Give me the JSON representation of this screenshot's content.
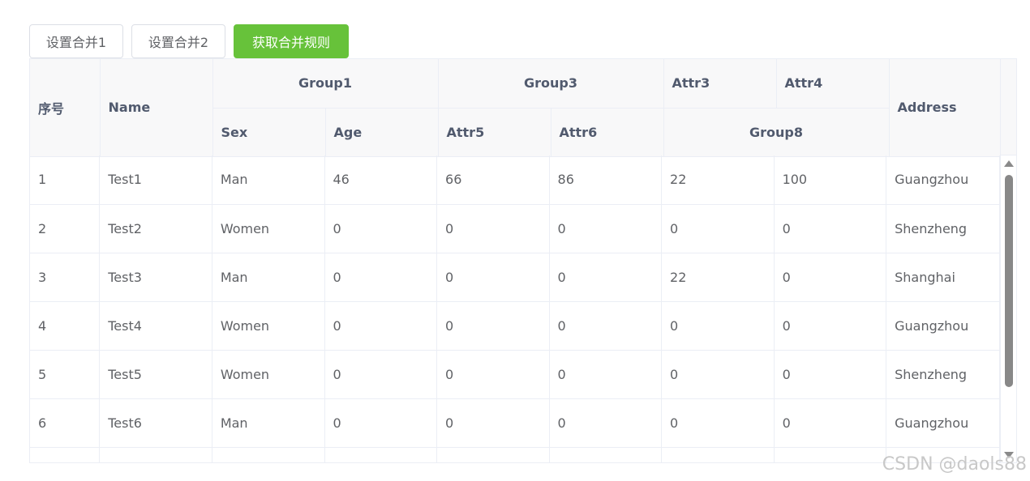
{
  "toolbar": {
    "btn1": "设置合并1",
    "btn2": "设置合并2",
    "btn3": "获取合并规则",
    "primary_color": "#67c23a"
  },
  "header": {
    "index": "序号",
    "name": "Name",
    "group1": "Group1",
    "group3": "Group3",
    "attr3": "Attr3",
    "attr4": "Attr4",
    "address": "Address",
    "sex": "Sex",
    "age": "Age",
    "attr5": "Attr5",
    "attr6": "Attr6",
    "group8": "Group8"
  },
  "rows": [
    {
      "index": "1",
      "name": "Test1",
      "sex": "Man",
      "age": "46",
      "attr5": "66",
      "attr6": "86",
      "attr3": "22",
      "attr4": "100",
      "address": "Guangzhou"
    },
    {
      "index": "2",
      "name": "Test2",
      "sex": "Women",
      "age": "0",
      "attr5": "0",
      "attr6": "0",
      "attr3": "0",
      "attr4": "0",
      "address": "Shenzheng"
    },
    {
      "index": "3",
      "name": "Test3",
      "sex": "Man",
      "age": "0",
      "attr5": "0",
      "attr6": "0",
      "attr3": "22",
      "attr4": "0",
      "address": "Shanghai"
    },
    {
      "index": "4",
      "name": "Test4",
      "sex": "Women",
      "age": "0",
      "attr5": "0",
      "attr6": "0",
      "attr3": "0",
      "attr4": "0",
      "address": "Guangzhou"
    },
    {
      "index": "5",
      "name": "Test5",
      "sex": "Women",
      "age": "0",
      "attr5": "0",
      "attr6": "0",
      "attr3": "0",
      "attr4": "0",
      "address": "Shenzheng"
    },
    {
      "index": "6",
      "name": "Test6",
      "sex": "Man",
      "age": "0",
      "attr5": "0",
      "attr6": "0",
      "attr3": "0",
      "attr4": "0",
      "address": "Guangzhou"
    }
  ],
  "watermark": "CSDN @daols88"
}
